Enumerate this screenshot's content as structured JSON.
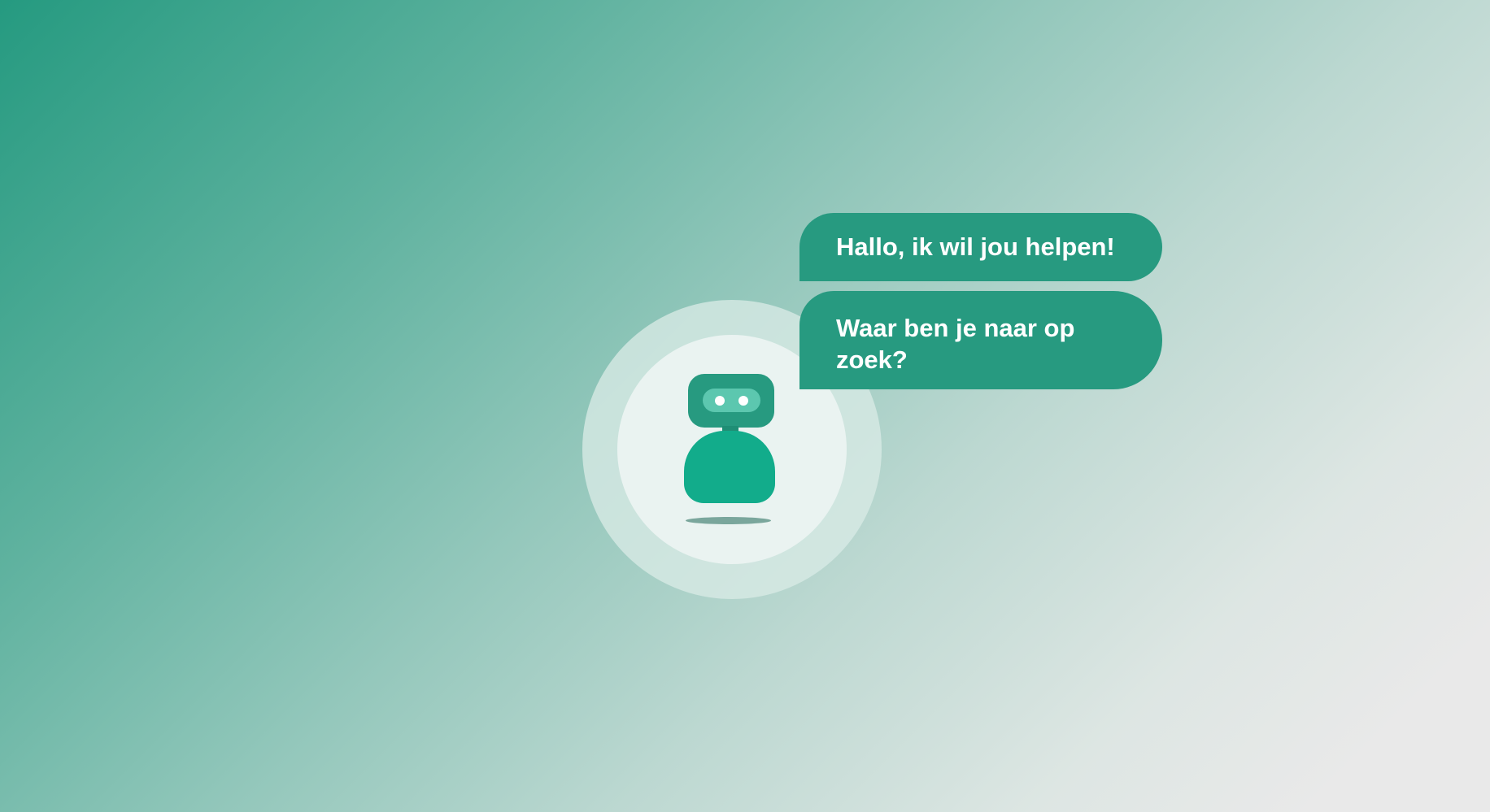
{
  "chat": {
    "messages": [
      {
        "text": "Hallo, ik wil jou helpen!"
      },
      {
        "text": "Waar ben je naar op zoek?"
      }
    ]
  },
  "colors": {
    "brand_green": "#279a80",
    "robot_body": "#12ac8b",
    "robot_visor": "#5cc7af",
    "background_start": "#259a80",
    "background_end": "#e9e9e9"
  },
  "icons": {
    "assistant": "robot-icon"
  }
}
